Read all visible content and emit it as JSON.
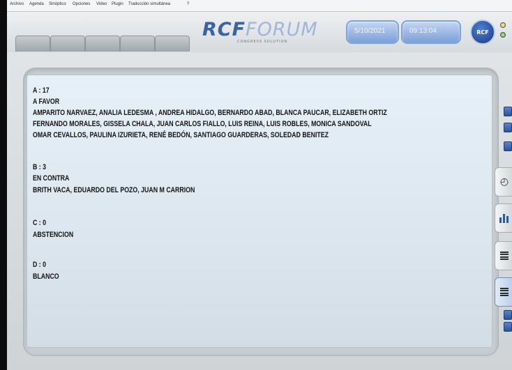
{
  "menu": [
    "Archivo",
    "Agenda",
    "Sinóptico",
    "Opciones",
    "Video",
    "Plugin",
    "Traducción simultánea",
    "?"
  ],
  "header": {
    "logo_brand": "RCFFORUM",
    "logo_tagline": "CONGRESS SOLUTION",
    "date": "5/10/2021",
    "time": "09:13:04",
    "badge": "RCF"
  },
  "vote": {
    "a_count": "A : 17",
    "a_label": "A FAVOR",
    "a_names": [
      "AMPARITO NARVAEZ, ANALIA LEDESMA , ANDREA HIDALGO, BERNARDO ABAD, BLANCA PAUCAR, ELIZABETH ORTIZ",
      "FERNANDO MORALES, GISSELA CHALA, JUAN CARLOS FIALLO, LUIS REINA, LUIS ROBLES, MONICA SANDOVAL",
      "OMAR CEVALLOS, PAULINA IZURIETA, RENÉ BEDÓN, SANTIAGO GUARDERAS, SOLEDAD BENITEZ"
    ],
    "b_count": "B : 3",
    "b_label": "EN CONTRA",
    "b_names": [
      "BRITH VACA, EDUARDO DEL POZO, JUAN M CARRION"
    ],
    "c_count": "C : 0",
    "c_label": "ABSTENCION",
    "d_count": "D : 0",
    "d_label": "BLANCO"
  },
  "icons": {
    "accent": "#3a62a6",
    "toolbar": [
      "clock-icon",
      "bar-chart-icon",
      "list-icon",
      "list-icon"
    ]
  }
}
